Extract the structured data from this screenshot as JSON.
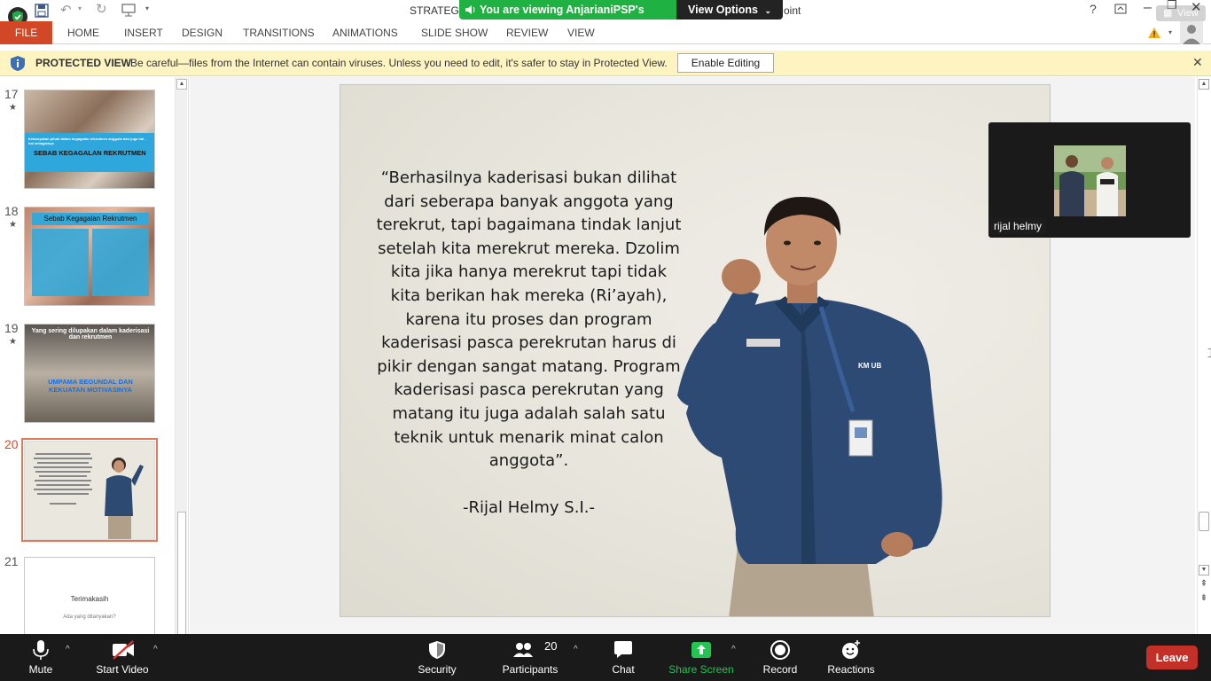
{
  "window": {
    "title_left": "STRATEGI M",
    "title_right": "oint",
    "help": "?",
    "view_chip": "View"
  },
  "share_banner": {
    "text": "You are viewing AnjarianiPSP's screen",
    "view_options": "View Options"
  },
  "ribbon": {
    "file": "FILE",
    "tabs": [
      "HOME",
      "INSERT",
      "DESIGN",
      "TRANSITIONS",
      "ANIMATIONS",
      "SLIDE SHOW",
      "REVIEW",
      "VIEW"
    ]
  },
  "protected_view": {
    "title": "PROTECTED VIEW",
    "message": "Be careful—files from the Internet can contain viruses. Unless you need to edit, it's safer to stay in Protected View.",
    "button": "Enable Editing"
  },
  "thumbnails": [
    {
      "num": "17",
      "star": "★",
      "title": "SEBAB KEGAGALAN REKRUTMEN",
      "text": "Kebanyakan pihak dalam kegagalan rekrutmen anggota dan juga hal - hal sebagainya"
    },
    {
      "num": "18",
      "star": "★",
      "title": "Sebab Kegagalan Rekrutmen"
    },
    {
      "num": "19",
      "star": "★",
      "title": "Yang sering dilupakan dalam kaderisasi dan rekrutmen",
      "subtitle": "UMPAMA BEGUNDAL DAN KEKUATAN MOTIVASINYA"
    },
    {
      "num": "20",
      "star": "",
      "selected": true
    },
    {
      "num": "21",
      "star": "",
      "title": "Terimakasih",
      "subtitle": "Ada yang ditanyakan?"
    }
  ],
  "slide": {
    "quote": "“Berhasilnya kaderisasi bukan dilihat dari seberapa banyak anggota yang terekrut, tapi bagaimana tindak lanjut setelah kita merekrut mereka. Dzolim kita jika hanya merekrut tapi tidak kita berikan hak mereka (Ri’ayah), karena itu proses dan program kaderisasi pasca perekrutan harus di pikir dengan sangat matang. Program kaderisasi pasca perekrutan yang matang itu juga adalah salah satu teknik untuk menarik minat calon anggota”.",
    "author": "-Rijal Helmy S.I.-",
    "badge_text": "KM UB"
  },
  "participant": {
    "name": "rijal helmy"
  },
  "zoom_toolbar": {
    "mute": "Mute",
    "start_video": "Start Video",
    "security": "Security",
    "participants": "Participants",
    "participants_count": "20",
    "chat": "Chat",
    "share_screen": "Share Screen",
    "record": "Record",
    "reactions": "Reactions",
    "leave": "Leave"
  },
  "colors": {
    "file_tab": "#d24726",
    "share_green": "#1fb141",
    "leave_red": "#c33027",
    "protected_bar": "#fdf4c2"
  }
}
